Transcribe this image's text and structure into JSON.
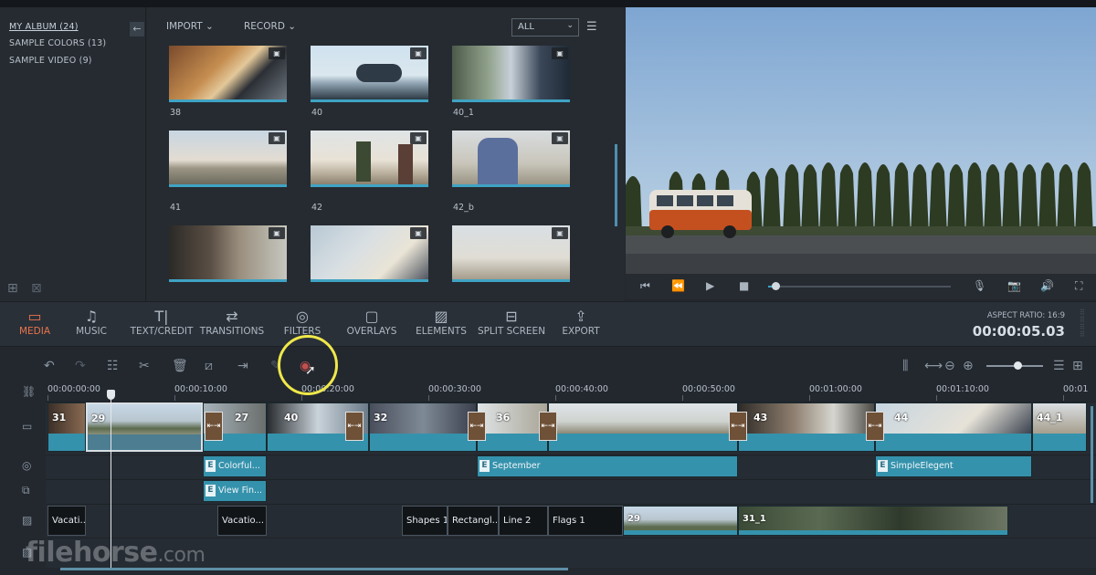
{
  "album": {
    "items": [
      "MY ALBUM (24)",
      "SAMPLE COLORS (13)",
      "SAMPLE VIDEO (9)"
    ],
    "collapse_icon": "arrow-left-icon"
  },
  "library": {
    "menus": [
      "IMPORT",
      "RECORD"
    ],
    "filter_value": "ALL",
    "thumbnails": [
      {
        "label": "38",
        "video": false
      },
      {
        "label": "40",
        "video": true
      },
      {
        "label": "40_1",
        "video": true
      },
      {
        "label": "41",
        "video": true
      },
      {
        "label": "42",
        "video": true
      },
      {
        "label": "42_b",
        "video": true
      },
      {
        "label": "",
        "video": true
      },
      {
        "label": "",
        "video": true
      },
      {
        "label": "",
        "video": true
      }
    ]
  },
  "preview": {
    "playback_progress": 0.04
  },
  "nav": {
    "items": [
      "MEDIA",
      "MUSIC",
      "TEXT/CREDIT",
      "TRANSITIONS",
      "FILTERS",
      "OVERLAYS",
      "ELEMENTS",
      "SPLIT SCREEN",
      "EXPORT"
    ],
    "active": "MEDIA",
    "aspect_ratio": "ASPECT RATIO: 16:9",
    "timecode": "00:00:05.03"
  },
  "timeline": {
    "zoom_level": 0.55,
    "ruler": [
      "00:00:00:00",
      "00:00:10:00",
      "00:00:20:00",
      "00:00:30:00",
      "00:00:40:00",
      "00:00:50:00",
      "00:01:00:00",
      "00:01:10:00",
      "00:01"
    ],
    "video_clips": [
      "31",
      "29",
      "27",
      "40",
      "32",
      "36",
      "",
      "43",
      "44",
      "44_1"
    ],
    "filter_clips": [
      "Colorful...",
      "September",
      "SimpleElegent"
    ],
    "overlay_clips": [
      "View Fin..."
    ],
    "element_clips": [
      "Vacati...",
      "Vacatio...",
      "Shapes 1",
      "Rectangl...",
      "Line 2",
      "Flags 1"
    ],
    "photo_clips": [
      "29",
      "31_1"
    ],
    "accent_color": "#3592ac",
    "highlight_color": "#efe84a"
  },
  "watermark": {
    "brand": "filehorse",
    "tld": ".com"
  }
}
